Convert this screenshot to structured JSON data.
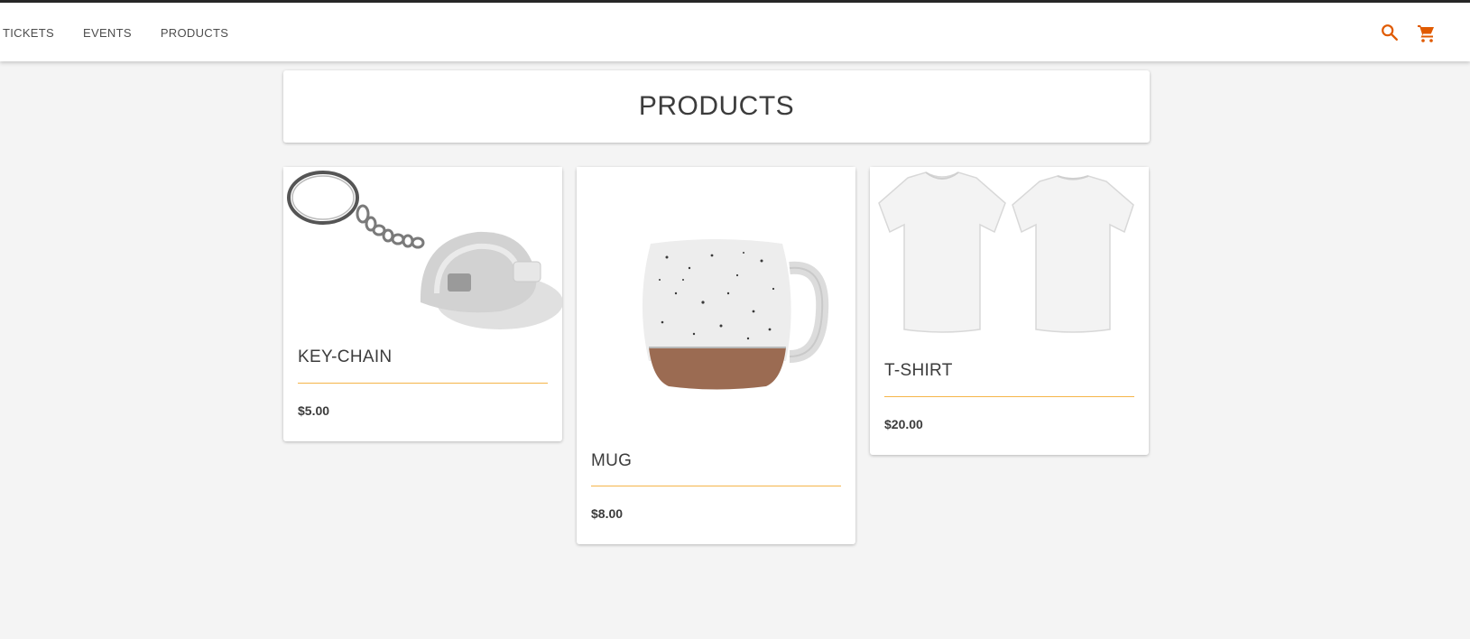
{
  "nav": {
    "items": [
      {
        "label": "TICKETS"
      },
      {
        "label": "EVENTS"
      },
      {
        "label": "PRODUCTS"
      }
    ]
  },
  "header_icons": [
    "search-icon",
    "cart-icon"
  ],
  "colors": {
    "accent": "#e05a00",
    "divider": "#f5b54a",
    "background": "#f4f4f4"
  },
  "page": {
    "title": "PRODUCTS"
  },
  "products": [
    {
      "name": "KEY-CHAIN",
      "price": "$5.00",
      "image": "key-chain-image"
    },
    {
      "name": "MUG",
      "price": "$8.00",
      "image": "mug-image"
    },
    {
      "name": "T-SHIRT",
      "price": "$20.00",
      "image": "t-shirt-image"
    }
  ]
}
